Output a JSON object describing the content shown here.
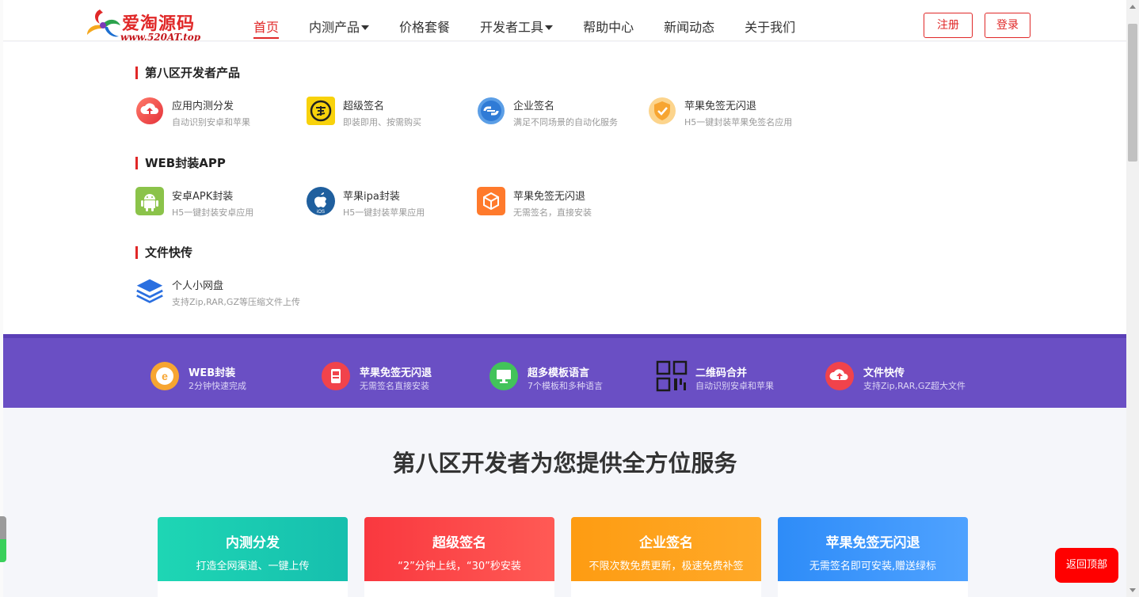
{
  "header": {
    "logo_text": "爱淘源码",
    "logo_url": "www.520AT.top",
    "nav": [
      {
        "label": "首页",
        "active": true,
        "has_caret": false
      },
      {
        "label": "内测产品",
        "active": false,
        "has_caret": true
      },
      {
        "label": "价格套餐",
        "active": false,
        "has_caret": false
      },
      {
        "label": "开发者工具",
        "active": false,
        "has_caret": true
      },
      {
        "label": "帮助中心",
        "active": false,
        "has_caret": false
      },
      {
        "label": "新闻动态",
        "active": false,
        "has_caret": false
      },
      {
        "label": "关于我们",
        "active": false,
        "has_caret": false
      }
    ],
    "register_label": "注册",
    "login_label": "登录"
  },
  "dropdown": {
    "sections": [
      {
        "title": "第八区开发者产品",
        "items": [
          {
            "name": "应用内测分发",
            "desc": "自动识别安卓和苹果",
            "icon": "upload-cloud-icon"
          },
          {
            "name": "超级签名",
            "desc": "即装即用、按需购买",
            "icon": "signature-seal-icon"
          },
          {
            "name": "企业签名",
            "desc": "满足不同场景的自动化服务",
            "icon": "enterprise-link-icon"
          },
          {
            "name": "苹果免签无闪退",
            "desc": "H5一键封装苹果免签名应用",
            "icon": "shield-check-icon"
          }
        ]
      },
      {
        "title": "WEB封装APP",
        "items": [
          {
            "name": "安卓APK封装",
            "desc": "H5一键封装安卓应用",
            "icon": "android-icon"
          },
          {
            "name": "苹果ipa封装",
            "desc": "H5一键封装苹果应用",
            "icon": "apple-ios-icon"
          },
          {
            "name": "苹果免签无闪退",
            "desc": "无需签名，直接安装",
            "icon": "package-box-icon"
          }
        ]
      },
      {
        "title": "文件快传",
        "items": [
          {
            "name": "个人小网盘",
            "desc": "支持Zip,RAR,GZ等压缩文件上传",
            "icon": "layers-stack-icon"
          }
        ]
      }
    ]
  },
  "features": [
    {
      "name": "WEB封装",
      "desc": "2分钟快速完成",
      "icon": "web-package-icon"
    },
    {
      "name": "苹果免签无闪退",
      "desc": "无需签名直接安装",
      "icon": "phone-app-icon"
    },
    {
      "name": "超多模板语言",
      "desc": "7个模板和多种语言",
      "icon": "monitor-icon"
    },
    {
      "name": "二维码合并",
      "desc": "自动识别安卓和苹果",
      "icon": "qr-code-icon"
    },
    {
      "name": "文件快传",
      "desc": "支持Zip,RAR,GZ超大文件",
      "icon": "cloud-upload-icon"
    }
  ],
  "services": {
    "title": "第八区开发者为您提供全方位服务",
    "cards": [
      {
        "title": "内测分发",
        "desc": "打造全网渠道、一键上传",
        "color_from": "#1ed6b4",
        "color_to": "#16bfae"
      },
      {
        "title": "超级签名",
        "desc": "“2”分钟上线，“30”秒安装",
        "color_from": "#f9383f",
        "color_to": "#ff5a55"
      },
      {
        "title": "企业签名",
        "desc": "不限次数免费更新，极速免费补签",
        "color_from": "#fe9c12",
        "color_to": "#ffa928"
      },
      {
        "title": "苹果免签无闪退",
        "desc": "无需签名即可安装,赠送绿标",
        "color_from": "#2e8cf8",
        "color_to": "#4fa2ff"
      }
    ]
  },
  "back_to_top_label": "返回顶部",
  "colors": {
    "brand_red": "#e02828",
    "purple": "#6a4fc4",
    "back_top": "#ff0000"
  }
}
